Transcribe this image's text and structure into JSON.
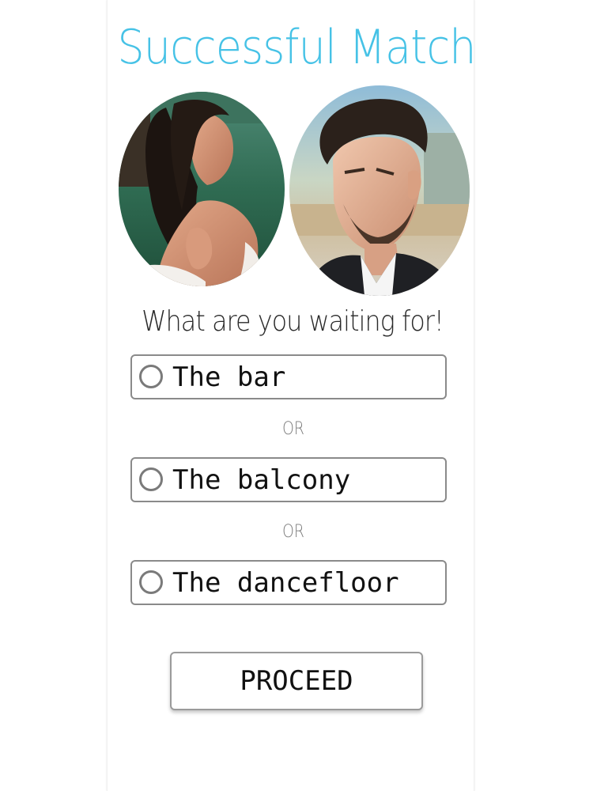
{
  "title": "Successful Match",
  "subtitle": "What are you waiting for!",
  "options": [
    {
      "label": "The bar",
      "selected": false
    },
    {
      "label": "The balcony",
      "selected": false
    },
    {
      "label": "The dancefloor",
      "selected": false
    }
  ],
  "separators": [
    "OR",
    "OR"
  ],
  "proceed_label": "PROCEED",
  "colors": {
    "title": "#46c2e6",
    "border": "#8a8a8a"
  },
  "images": {
    "left_profile": "woman-profile-photo",
    "right_profile": "man-profile-photo"
  }
}
